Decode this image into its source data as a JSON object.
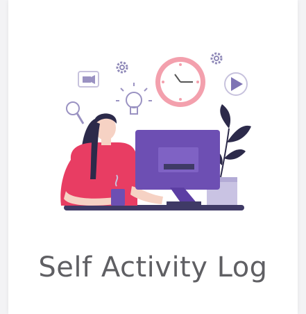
{
  "card": {
    "title": "Self Activity Log"
  },
  "illustration": {
    "icons": [
      "video-camera-icon",
      "gear-icon",
      "lightbulb-icon",
      "clock-icon",
      "play-icon",
      "magnifier-icon",
      "monitor-icon",
      "plant-icon",
      "coffee-cup-icon"
    ]
  },
  "colors": {
    "purple": "#6d4fb3",
    "purple_dark": "#3f3a66",
    "pink": "#e83d63",
    "clock_pink": "#f3a0ad",
    "text": "#5f5f63"
  }
}
